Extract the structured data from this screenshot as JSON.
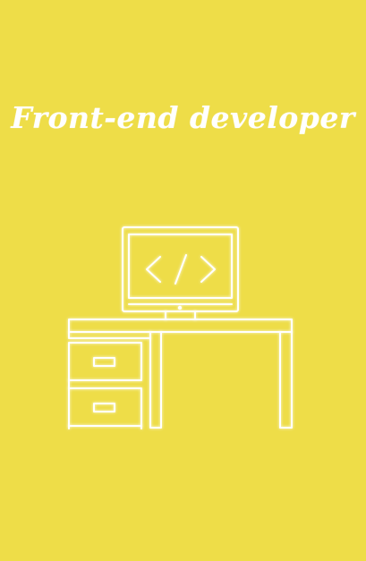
{
  "card": {
    "title": "Front-end developer",
    "background_color": "#eedd48",
    "foreground_color": "#ffffff"
  },
  "illustration": {
    "icon": "developer-desk-icon",
    "screen_glyph": "</>"
  }
}
